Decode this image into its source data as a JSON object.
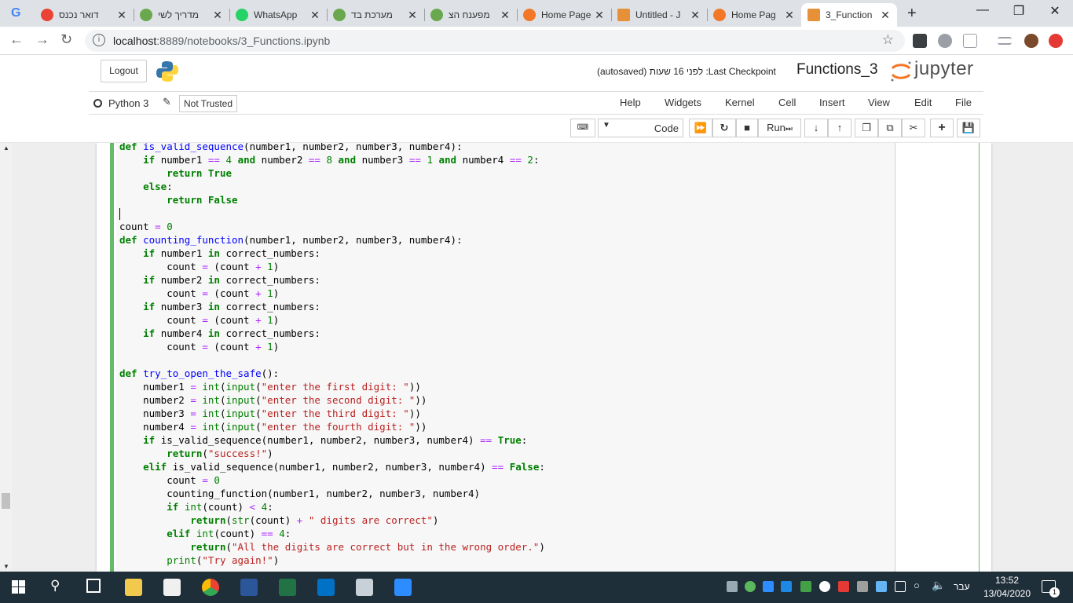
{
  "browser": {
    "tabs": [
      {
        "label": "דואר נכנס",
        "icon": "gmail-icon"
      },
      {
        "label": "מדריך לשי",
        "icon": "globe-icon"
      },
      {
        "label": "WhatsApp",
        "icon": "whatsapp-icon"
      },
      {
        "label": "מערכת בד",
        "icon": "globe-icon"
      },
      {
        "label": "מפענח הצ",
        "icon": "globe-icon"
      },
      {
        "label": "Home Page",
        "icon": "jupyter-icon"
      },
      {
        "label": "Untitled - J",
        "icon": "notebook-icon"
      },
      {
        "label": "Home Pag",
        "icon": "jupyter-icon"
      },
      {
        "label": "3_Function",
        "icon": "notebook-icon"
      }
    ],
    "url_host": "localhost",
    "url_rest": ":8889/notebooks/3_Functions.ipynb"
  },
  "jupyter": {
    "logout_label": "Logout",
    "save_status": "(autosaved)  לפני 16 שעות :Last Checkpoint",
    "notebook_name": "Functions_3",
    "brand": "jupyter",
    "kernel_name": "Python 3",
    "trusted_label": "Not Trusted",
    "menu": [
      "Help",
      "Widgets",
      "Kernel",
      "Cell",
      "Insert",
      "View",
      "Edit",
      "File"
    ],
    "run_label": "Run",
    "cell_type": "Code"
  },
  "code_lines": [
    "def is_valid_sequence(number1, number2, number3, number4):",
    "    if number1 == 4 and number2 == 8 and number3 == 1 and number4 == 2:",
    "        return True",
    "    else:",
    "        return False",
    "",
    "count = 0",
    "def counting_function(number1, number2, number3, number4):",
    "    if number1 in correct_numbers:",
    "        count = (count + 1)",
    "    if number2 in correct_numbers:",
    "        count = (count + 1)",
    "    if number3 in correct_numbers:",
    "        count = (count + 1)",
    "    if number4 in correct_numbers:",
    "        count = (count + 1)",
    "",
    "def try_to_open_the_safe():",
    "    number1 = int(input(\"enter the first digit: \"))",
    "    number2 = int(input(\"enter the second digit: \"))",
    "    number3 = int(input(\"enter the third digit: \"))",
    "    number4 = int(input(\"enter the fourth digit: \"))",
    "    if is_valid_sequence(number1, number2, number3, number4) == True:",
    "        return(\"success!\")",
    "    elif is_valid_sequence(number1, number2, number3, number4) == False:",
    "        count = 0",
    "        counting_function(number1, number2, number3, number4)",
    "        if int(count) < 4:",
    "            return(str(count) + \" digits are correct\")",
    "        elif int(count) == 4:",
    "            return(\"All the digits are correct but in the wrong order.\")",
    "        print(\"Try again!\")"
  ],
  "taskbar": {
    "language": "עבר",
    "time": "13:52",
    "date": "13/04/2020",
    "notifications": "1"
  }
}
